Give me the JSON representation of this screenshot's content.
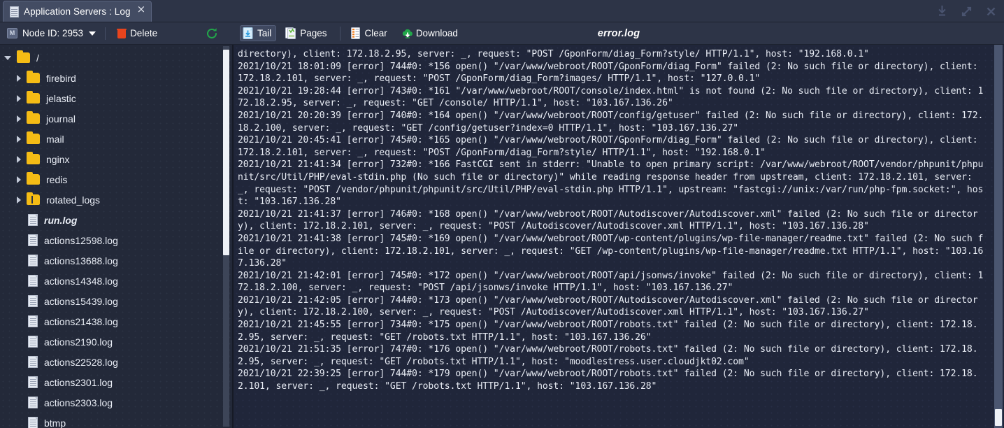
{
  "window": {
    "tab_title": "Application Servers : Log",
    "tab_close_label": "×",
    "controls": [
      {
        "name": "download",
        "label": "Download"
      },
      {
        "name": "expand",
        "label": "Expand"
      },
      {
        "name": "close",
        "label": "Close"
      }
    ]
  },
  "toolbar": {
    "node_id_label": "Node ID: 2953",
    "node_badge": "M",
    "delete_label": "Delete",
    "refresh_label": "Refresh",
    "tail_label": "Tail",
    "pages_label": "Pages",
    "clear_label": "Clear",
    "download_label": "Download",
    "file_title": "error.log",
    "accent_delete": "#e8441d",
    "accent_refresh": "#22a84a",
    "accent_download": "#22a84a",
    "active_button": "Tail"
  },
  "sidebar": {
    "items": [
      {
        "label": "/",
        "type": "folder",
        "depth": 0,
        "expanded": true,
        "selected": false
      },
      {
        "label": "firebird",
        "type": "folder",
        "depth": 1,
        "expanded": false,
        "selected": false
      },
      {
        "label": "jelastic",
        "type": "folder",
        "depth": 1,
        "expanded": false,
        "selected": false
      },
      {
        "label": "journal",
        "type": "folder",
        "depth": 1,
        "expanded": false,
        "selected": false
      },
      {
        "label": "mail",
        "type": "folder",
        "depth": 1,
        "expanded": false,
        "selected": false
      },
      {
        "label": "nginx",
        "type": "folder",
        "depth": 1,
        "expanded": false,
        "selected": false
      },
      {
        "label": "redis",
        "type": "folder",
        "depth": 1,
        "expanded": false,
        "selected": false
      },
      {
        "label": "rotated_logs",
        "type": "archive",
        "depth": 1,
        "expanded": false,
        "selected": false
      },
      {
        "label": "run.log",
        "type": "file",
        "depth": 1,
        "expanded": false,
        "selected": true
      },
      {
        "label": "actions12598.log",
        "type": "file",
        "depth": 1,
        "expanded": false,
        "selected": false
      },
      {
        "label": "actions13688.log",
        "type": "file",
        "depth": 1,
        "expanded": false,
        "selected": false
      },
      {
        "label": "actions14348.log",
        "type": "file",
        "depth": 1,
        "expanded": false,
        "selected": false
      },
      {
        "label": "actions15439.log",
        "type": "file",
        "depth": 1,
        "expanded": false,
        "selected": false
      },
      {
        "label": "actions21438.log",
        "type": "file",
        "depth": 1,
        "expanded": false,
        "selected": false
      },
      {
        "label": "actions2190.log",
        "type": "file",
        "depth": 1,
        "expanded": false,
        "selected": false
      },
      {
        "label": "actions22528.log",
        "type": "file",
        "depth": 1,
        "expanded": false,
        "selected": false
      },
      {
        "label": "actions2301.log",
        "type": "file",
        "depth": 1,
        "expanded": false,
        "selected": false
      },
      {
        "label": "actions2303.log",
        "type": "file",
        "depth": 1,
        "expanded": false,
        "selected": false
      },
      {
        "label": "btmp",
        "type": "file",
        "depth": 1,
        "expanded": false,
        "selected": false
      }
    ],
    "scrollbar": {
      "thumb_top_pct": 1,
      "thumb_height_pct": 54
    }
  },
  "log": {
    "scrollbar": {
      "thumb_top_pct": 95,
      "thumb_height_pct": 4.5
    },
    "content": "directory), client: 172.18.2.95, server: _, request: \"POST /GponForm/diag_Form?style/ HTTP/1.1\", host: \"192.168.0.1\"\n2021/10/21 18:01:09 [error] 744#0: *156 open() \"/var/www/webroot/ROOT/GponForm/diag_Form\" failed (2: No such file or directory), client: 172.18.2.101, server: _, request: \"POST /GponForm/diag_Form?images/ HTTP/1.1\", host: \"127.0.0.1\"\n2021/10/21 19:28:44 [error] 743#0: *161 \"/var/www/webroot/ROOT/console/index.html\" is not found (2: No such file or directory), client: 172.18.2.95, server: _, request: \"GET /console/ HTTP/1.1\", host: \"103.167.136.26\"\n2021/10/21 20:20:39 [error] 740#0: *164 open() \"/var/www/webroot/ROOT/config/getuser\" failed (2: No such file or directory), client: 172.18.2.100, server: _, request: \"GET /config/getuser?index=0 HTTP/1.1\", host: \"103.167.136.27\"\n2021/10/21 20:45:41 [error] 745#0: *165 open() \"/var/www/webroot/ROOT/GponForm/diag_Form\" failed (2: No such file or directory), client: 172.18.2.101, server: _, request: \"POST /GponForm/diag_Form?style/ HTTP/1.1\", host: \"192.168.0.1\"\n2021/10/21 21:41:34 [error] 732#0: *166 FastCGI sent in stderr: \"Unable to open primary script: /var/www/webroot/ROOT/vendor/phpunit/phpunit/src/Util/PHP/eval-stdin.php (No such file or directory)\" while reading response header from upstream, client: 172.18.2.101, server: _, request: \"POST /vendor/phpunit/phpunit/src/Util/PHP/eval-stdin.php HTTP/1.1\", upstream: \"fastcgi://unix:/var/run/php-fpm.socket:\", host: \"103.167.136.28\"\n2021/10/21 21:41:37 [error] 746#0: *168 open() \"/var/www/webroot/ROOT/Autodiscover/Autodiscover.xml\" failed (2: No such file or directory), client: 172.18.2.101, server: _, request: \"POST /Autodiscover/Autodiscover.xml HTTP/1.1\", host: \"103.167.136.28\"\n2021/10/21 21:41:38 [error] 745#0: *169 open() \"/var/www/webroot/ROOT/wp-content/plugins/wp-file-manager/readme.txt\" failed (2: No such file or directory), client: 172.18.2.101, server: _, request: \"GET /wp-content/plugins/wp-file-manager/readme.txt HTTP/1.1\", host: \"103.167.136.28\"\n2021/10/21 21:42:01 [error] 745#0: *172 open() \"/var/www/webroot/ROOT/api/jsonws/invoke\" failed (2: No such file or directory), client: 172.18.2.100, server: _, request: \"POST /api/jsonws/invoke HTTP/1.1\", host: \"103.167.136.27\"\n2021/10/21 21:42:05 [error] 744#0: *173 open() \"/var/www/webroot/ROOT/Autodiscover/Autodiscover.xml\" failed (2: No such file or directory), client: 172.18.2.100, server: _, request: \"POST /Autodiscover/Autodiscover.xml HTTP/1.1\", host: \"103.167.136.27\"\n2021/10/21 21:45:55 [error] 734#0: *175 open() \"/var/www/webroot/ROOT/robots.txt\" failed (2: No such file or directory), client: 172.18.2.95, server: _, request: \"GET /robots.txt HTTP/1.1\", host: \"103.167.136.26\"\n2021/10/21 21:51:35 [error] 747#0: *176 open() \"/var/www/webroot/ROOT/robots.txt\" failed (2: No such file or directory), client: 172.18.2.95, server: _, request: \"GET /robots.txt HTTP/1.1\", host: \"moodlestress.user.cloudjkt02.com\"\n2021/10/21 22:39:25 [error] 744#0: *179 open() \"/var/www/webroot/ROOT/robots.txt\" failed (2: No such file or directory), client: 172.18.2.101, server: _, request: \"GET /robots.txt HTTP/1.1\", host: \"103.167.136.28\""
  }
}
